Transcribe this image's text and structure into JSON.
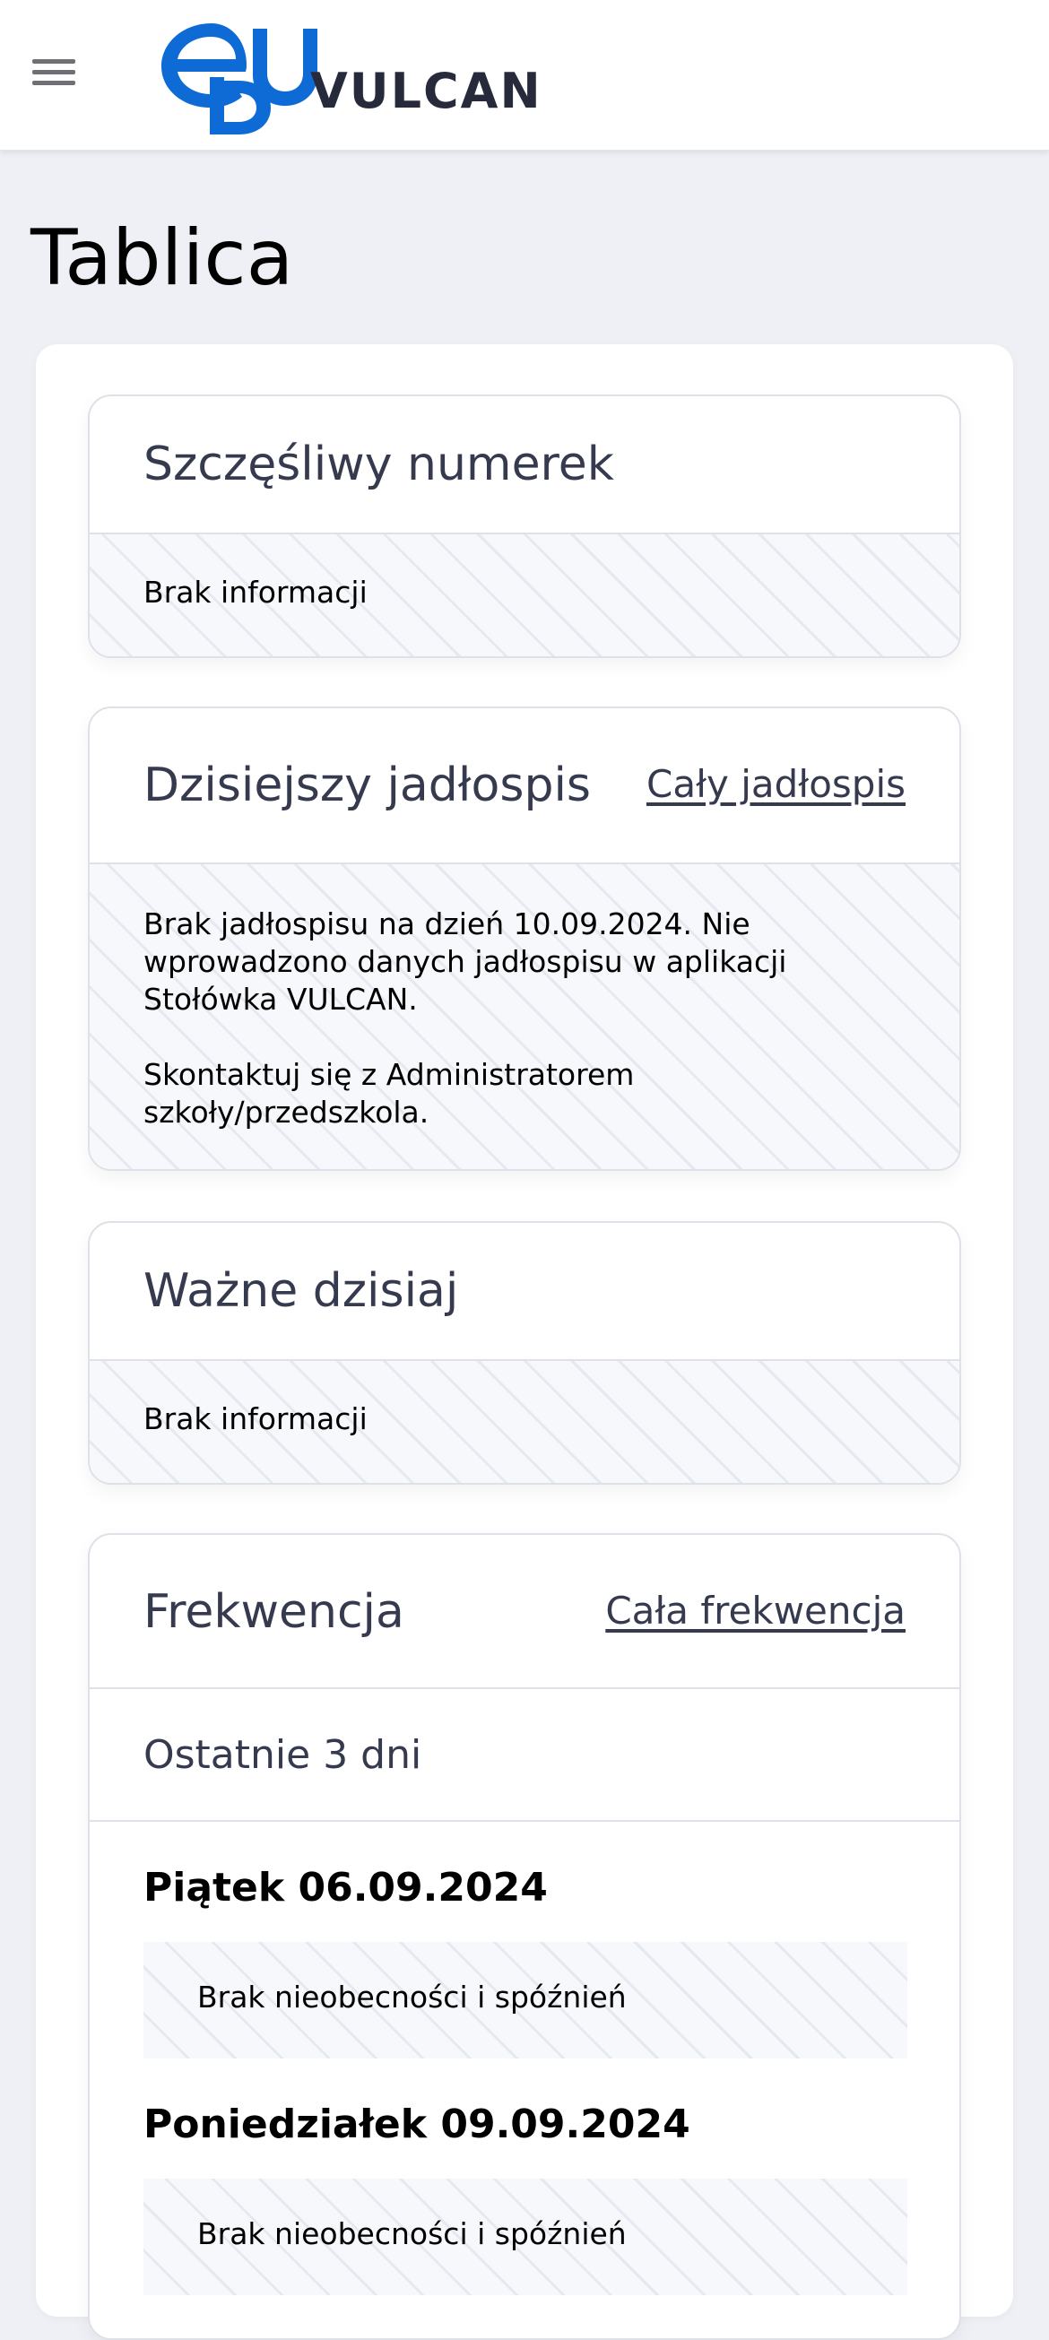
{
  "header": {
    "menu_icon": "hamburger-menu-icon",
    "logo_text": "VULCAN",
    "logo_mark": "edu",
    "brand_color": "#0e6ad4"
  },
  "page": {
    "title": "Tablica"
  },
  "cards": {
    "lucky_number": {
      "title": "Szczęśliwy numerek",
      "body": "Brak informacji"
    },
    "menu": {
      "title": "Dzisiejszy jadłospis",
      "link": "Cały jadłospis",
      "body_line1": "Brak jadłospisu na dzień 10.09.2024. Nie",
      "body_line2": "wprowadzono danych jadłospisu w aplikacji",
      "body_line3": "Stołówka VULCAN.",
      "body_line4": "Skontaktuj się z Administratorem",
      "body_line5": "szkoły/przedszkola."
    },
    "important": {
      "title": "Ważne dzisiaj",
      "body": "Brak informacji"
    },
    "attendance": {
      "title": "Frekwencja",
      "link": "Cała frekwencja",
      "subtitle": "Ostatnie 3 dni",
      "days": [
        {
          "date": "Piątek 06.09.2024",
          "status": "Brak nieobecności i spóźnień"
        },
        {
          "date": "Poniedziałek 09.09.2024",
          "status": "Brak nieobecności i spóźnień"
        }
      ]
    }
  }
}
